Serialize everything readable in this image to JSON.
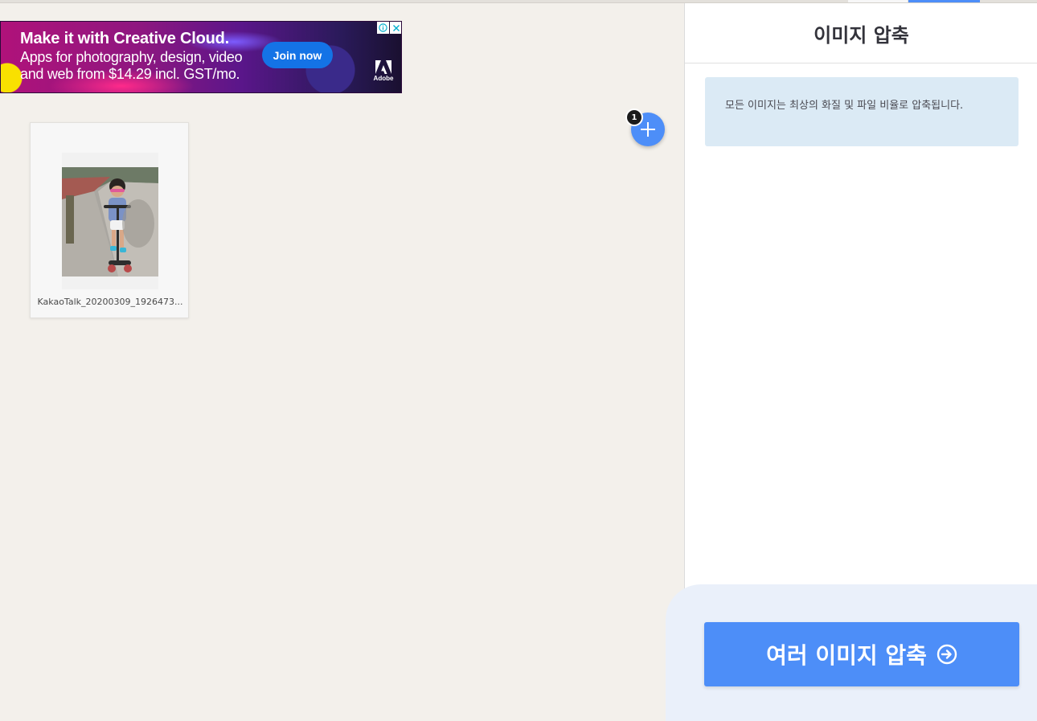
{
  "ad": {
    "title": "Make it with Creative Cloud.",
    "line1": "Apps for photography, design, video",
    "line2": "and web from $14.29 incl. GST/mo.",
    "cta": "Join now",
    "brand": "Adobe"
  },
  "workspace": {
    "file_count": "1",
    "files": [
      {
        "name": "KakaoTalk_20200309_1926473..."
      }
    ]
  },
  "sidebar": {
    "title": "이미지 압축",
    "info": "모든 이미지는 최상의 화질 및 파일 비율로 압축됩니다.",
    "action_label": "여러 이미지 압축"
  },
  "colors": {
    "accent": "#4d8ef8",
    "info_bg": "#dbeaf5",
    "workspace_bg": "#f3f0eb"
  }
}
